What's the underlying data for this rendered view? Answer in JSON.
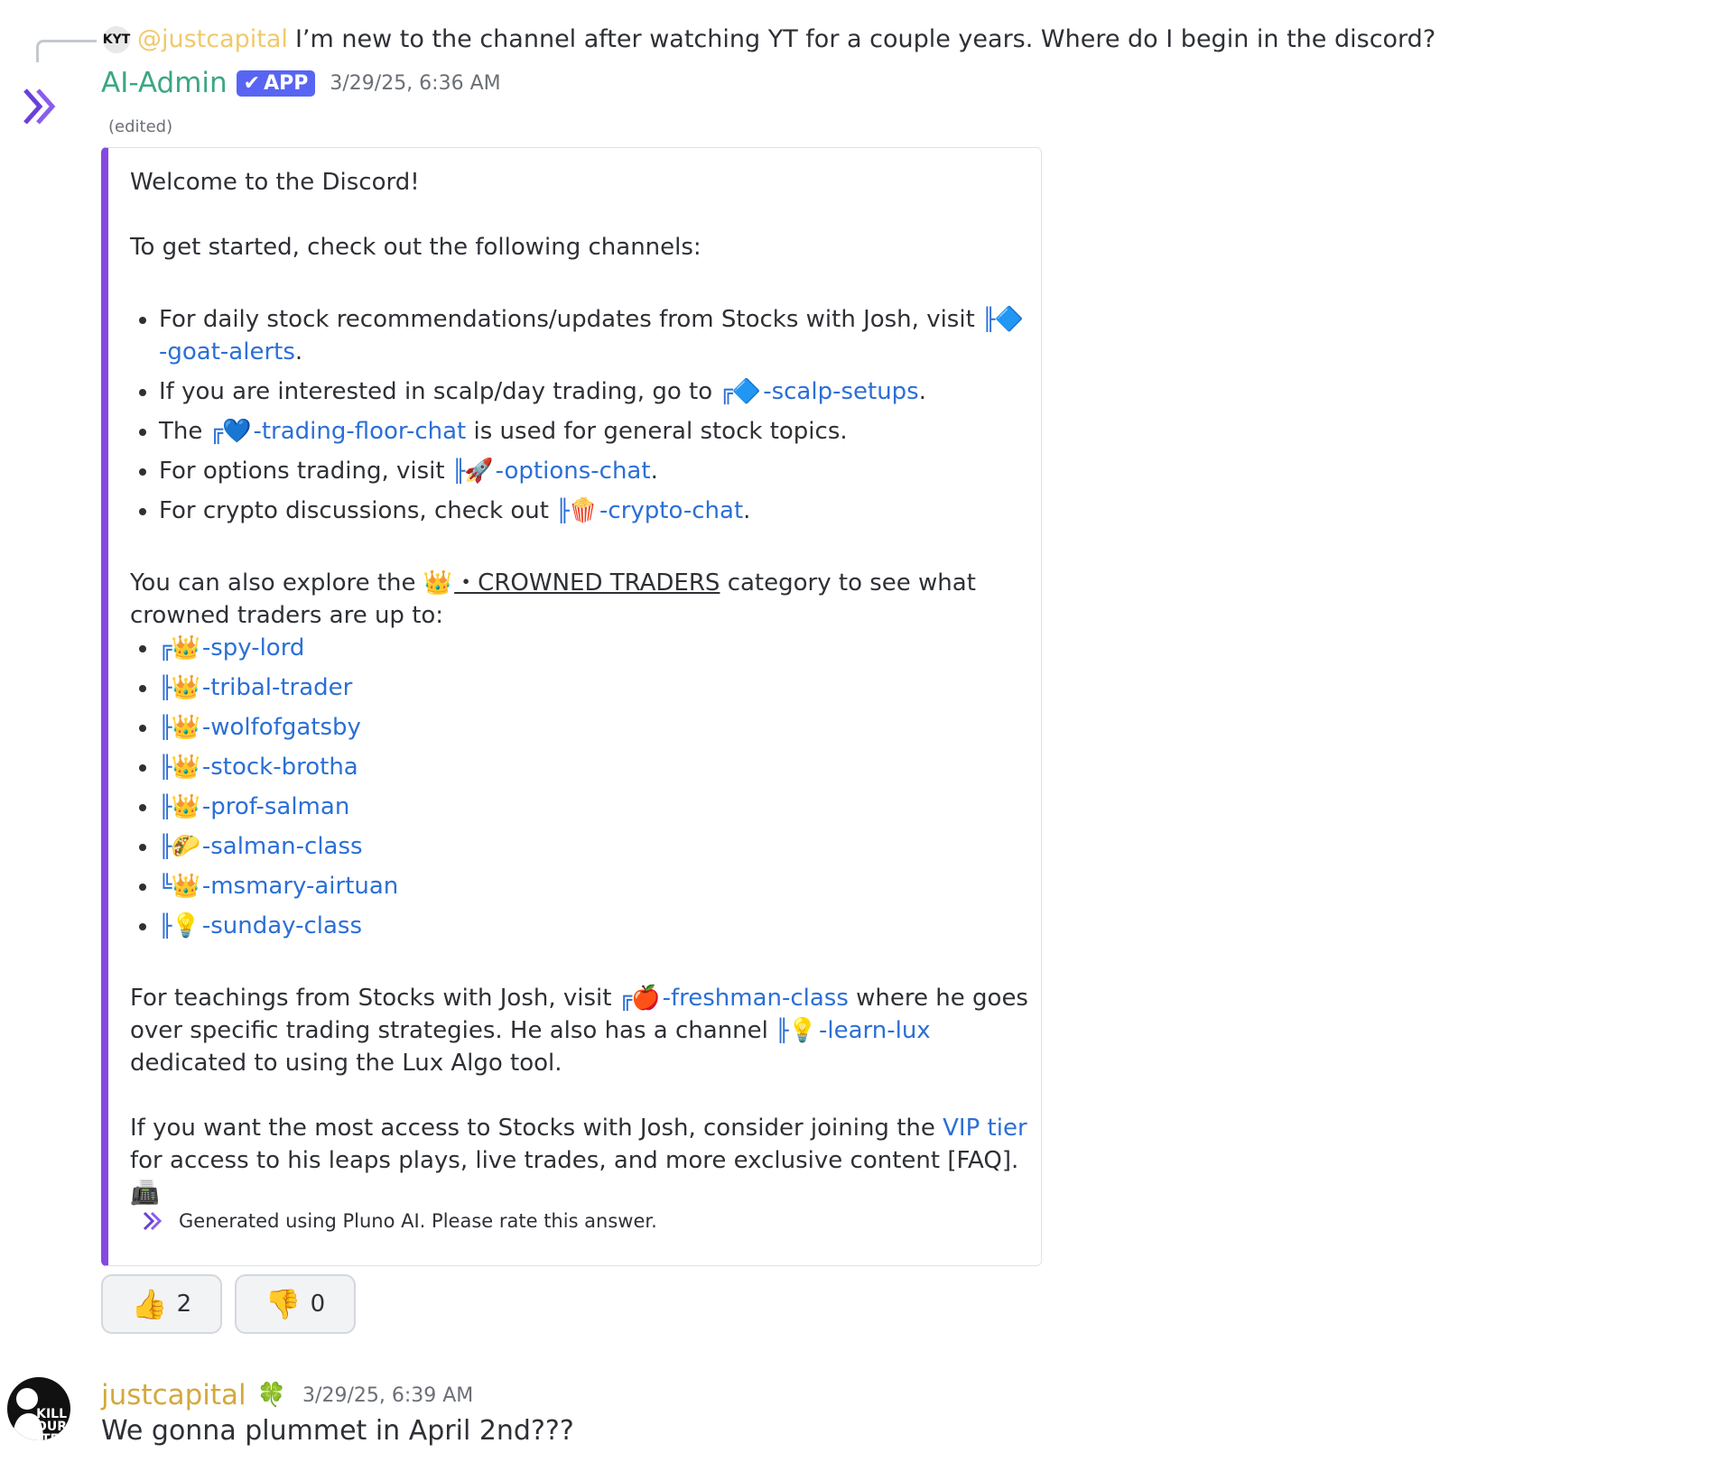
{
  "reply": {
    "avatar_text": "KYT",
    "user": "@justcapital",
    "text": "I’m new to the channel after watching YT for a couple years. Where do I begin in the discord?"
  },
  "bot": {
    "name": "AI-Admin",
    "badge": "APP",
    "timestamp": "3/29/25, 6:36 AM",
    "edited": "(edited)"
  },
  "embed": {
    "welcome": "Welcome to the Discord!",
    "intro": "To get started, check out the following channels:",
    "items": [
      {
        "before": "For daily stock recommendations/updates from Stocks with Josh, visit ",
        "prefix": "╟",
        "emoji": "🔷",
        "channel": "-goat-alerts",
        "after": "."
      },
      {
        "before": "If you are interested in scalp/day trading, go to ",
        "prefix": "╔",
        "emoji": "🔷",
        "channel": "-scalp-setups",
        "after": "."
      },
      {
        "before": "The ",
        "prefix": "╔",
        "emoji": "💙",
        "channel": "-trading-floor-chat",
        "after": " is used for general stock topics."
      },
      {
        "before": "For options trading, visit ",
        "prefix": "╟",
        "emoji": "🚀",
        "channel": "-options-chat",
        "after": "."
      },
      {
        "before": "For crypto discussions, check out ",
        "prefix": "╟",
        "emoji": "🍿",
        "channel": "-crypto-chat",
        "after": "."
      }
    ],
    "explore_before": "You can also explore the ",
    "explore_emoji": "👑",
    "explore_category": "・CROWNED TRADERS",
    "explore_after": " category to see what crowned traders are up to:",
    "crowned": [
      {
        "prefix": "╔",
        "emoji": "👑",
        "channel": "-spy-lord"
      },
      {
        "prefix": "╟",
        "emoji": "👑",
        "channel": "-tribal-trader"
      },
      {
        "prefix": "╟",
        "emoji": "👑",
        "channel": "-wolfofgatsby"
      },
      {
        "prefix": "╟",
        "emoji": "👑",
        "channel": "-stock-brotha"
      },
      {
        "prefix": "╟",
        "emoji": "👑",
        "channel": "-prof-salman"
      },
      {
        "prefix": "╟",
        "emoji": "🌮",
        "channel": "-salman-class"
      },
      {
        "prefix": "╚",
        "emoji": "👑",
        "channel": "-msmary-airtuan"
      },
      {
        "prefix": "╟",
        "emoji": "💡",
        "channel": "-sunday-class"
      }
    ],
    "teach": {
      "before": "For teachings from Stocks with Josh, visit ",
      "ch1_prefix": "╔",
      "ch1_emoji": "🍎",
      "ch1": "-freshman-class",
      "middle": " where he goes over specific trading strategies. He also has a channel ",
      "ch2_prefix": "╟",
      "ch2_emoji": "💡",
      "ch2": "-learn-lux",
      "after": " dedicated to using the Lux Algo tool."
    },
    "vip": {
      "before": "If you want the most access to Stocks with Josh, consider joining the ",
      "link": "VIP tier",
      "after": " for access to his leaps plays, live trades, and more exclusive content [FAQ]. ",
      "emoji": "📠"
    },
    "footer": "Generated using Pluno AI. Please rate this answer."
  },
  "reactions": [
    {
      "emoji": "👍",
      "count": "2"
    },
    {
      "emoji": "👎",
      "count": "0"
    }
  ],
  "message2": {
    "avatar_text": [
      "KILL",
      "YOUR",
      "TEL"
    ],
    "user": "justcapital",
    "badge_emoji": "🍀",
    "timestamp": "3/29/25, 6:39 AM",
    "text": "We gonna plummet in April 2nd???"
  },
  "colors": {
    "accent_bar": "#8549e0",
    "link": "#2b6fd6",
    "bot_name": "#3ba783",
    "app_badge": "#5865f2",
    "user_name": "#d4a93c"
  }
}
